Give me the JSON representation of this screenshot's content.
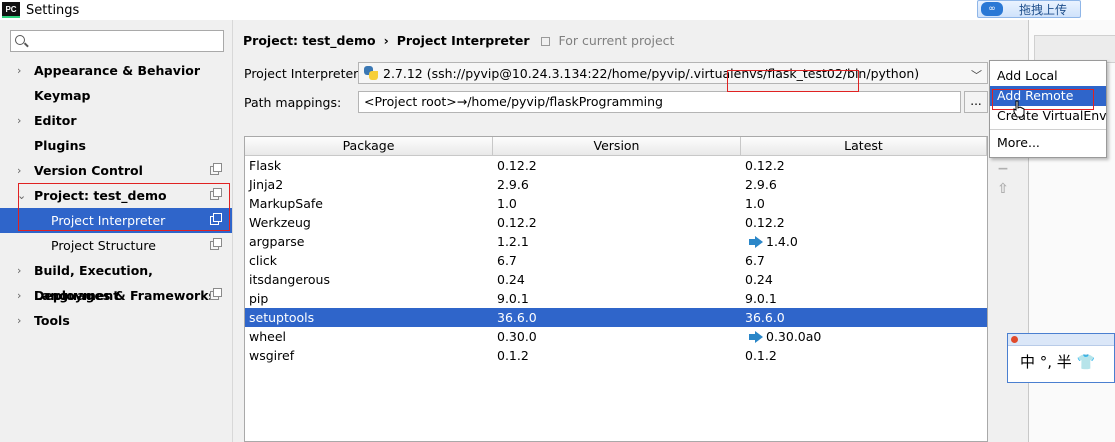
{
  "window": {
    "title": "Settings",
    "app_badge": "PC"
  },
  "background": {
    "upload_button": "拖拽上传"
  },
  "sidebar": {
    "search": {
      "value": "",
      "placeholder": ""
    },
    "items": [
      {
        "label": "Appearance & Behavior",
        "expandable": true,
        "copy": false
      },
      {
        "label": "Keymap",
        "expandable": false,
        "copy": false
      },
      {
        "label": "Editor",
        "expandable": true,
        "copy": false
      },
      {
        "label": "Plugins",
        "expandable": false,
        "copy": false
      },
      {
        "label": "Version Control",
        "expandable": true,
        "copy": true
      },
      {
        "label": "Project: test_demo",
        "expandable": true,
        "expanded": true,
        "copy": true
      },
      {
        "label": "Project Interpreter",
        "child": true,
        "selected": true,
        "copy": true
      },
      {
        "label": "Project Structure",
        "child": true,
        "copy": true
      },
      {
        "label": "Build, Execution, Deployment",
        "expandable": true,
        "copy": false
      },
      {
        "label": "Languages & Frameworks",
        "expandable": true,
        "copy": true
      },
      {
        "label": "Tools",
        "expandable": true,
        "copy": false
      }
    ]
  },
  "main": {
    "breadcrumb": {
      "project": "Project: test_demo",
      "separator": "›",
      "page": "Project Interpreter",
      "scope": "For current project"
    },
    "interpreter": {
      "label": "Project Interpreter:",
      "value": "2.7.12 (ssh://pyvip@10.24.3.134:22/home/pyvip/.virtualenvs/flask_test02/bin/python)"
    },
    "path_mappings": {
      "label": "Path mappings:",
      "value": "<Project root>→/home/pyvip/flaskProgramming",
      "button": "..."
    },
    "table": {
      "headers": [
        "Package",
        "Version",
        "Latest"
      ],
      "rows": [
        {
          "package": "Flask",
          "version": "0.12.2",
          "latest": "0.12.2",
          "upgrade": false
        },
        {
          "package": "Jinja2",
          "version": "2.9.6",
          "latest": "2.9.6",
          "upgrade": false
        },
        {
          "package": "MarkupSafe",
          "version": "1.0",
          "latest": "1.0",
          "upgrade": false
        },
        {
          "package": "Werkzeug",
          "version": "0.12.2",
          "latest": "0.12.2",
          "upgrade": false
        },
        {
          "package": "argparse",
          "version": "1.2.1",
          "latest": "1.4.0",
          "upgrade": true
        },
        {
          "package": "click",
          "version": "6.7",
          "latest": "6.7",
          "upgrade": false
        },
        {
          "package": "itsdangerous",
          "version": "0.24",
          "latest": "0.24",
          "upgrade": false
        },
        {
          "package": "pip",
          "version": "9.0.1",
          "latest": "9.0.1",
          "upgrade": false
        },
        {
          "package": "setuptools",
          "version": "36.6.0",
          "latest": "36.6.0",
          "upgrade": false,
          "selected": true
        },
        {
          "package": "wheel",
          "version": "0.30.0",
          "latest": "0.30.0a0",
          "upgrade": true
        },
        {
          "package": "wsgiref",
          "version": "0.1.2",
          "latest": "0.1.2",
          "upgrade": false
        }
      ]
    },
    "side_tools": [
      "+",
      "−",
      "⇧"
    ]
  },
  "menu": {
    "items": [
      "Add Local",
      "Add Remote",
      "Create VirtualEnv",
      "More..."
    ],
    "active_index": 1
  },
  "ime": {
    "text": "中 °, 半 👕"
  },
  "colors": {
    "selection": "#2f65ca",
    "highlight_box": "#e02222",
    "upgrade_arrow": "#2a86c8"
  }
}
